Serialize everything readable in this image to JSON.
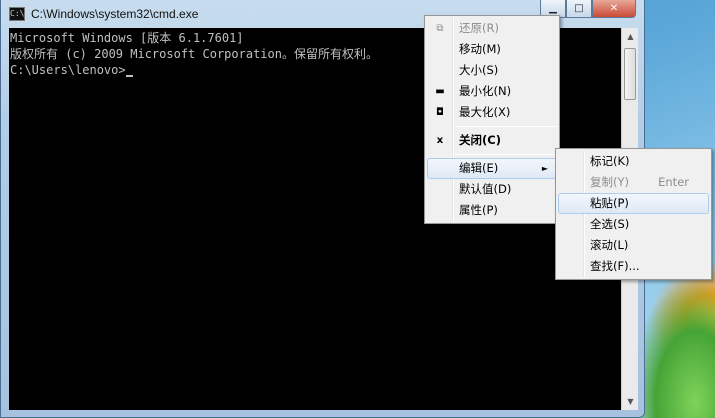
{
  "window": {
    "title": "C:\\Windows\\system32\\cmd.exe",
    "icon_text": "C:\\",
    "buttons": {
      "min": "▁",
      "max": "□",
      "close": "✕"
    }
  },
  "console": {
    "lines": [
      "Microsoft Windows [版本 6.1.7601]",
      "版权所有 (c) 2009 Microsoft Corporation。保留所有权利。",
      "",
      "C:\\Users\\lenovo>"
    ]
  },
  "scrollbar": {
    "up": "▲",
    "down": "▼"
  },
  "system_menu": {
    "items": [
      {
        "label": "还原(R)",
        "glyph": "⧉",
        "disabled": true
      },
      {
        "label": "移动(M)"
      },
      {
        "label": "大小(S)"
      },
      {
        "label": "最小化(N)",
        "glyph": "▬"
      },
      {
        "label": "最大化(X)",
        "glyph": "◘"
      },
      {
        "label": "关闭(C)",
        "glyph": "x"
      },
      {
        "label": "编辑(E)",
        "arrow": "►"
      },
      {
        "label": "默认值(D)"
      },
      {
        "label": "属性(P)"
      }
    ]
  },
  "edit_menu": {
    "items": [
      {
        "label": "标记(K)"
      },
      {
        "label": "复制(Y)",
        "shortcut": "Enter"
      },
      {
        "label": "粘贴(P)"
      },
      {
        "label": "全选(S)"
      },
      {
        "label": "滚动(L)"
      },
      {
        "label": "查找(F)..."
      }
    ]
  }
}
